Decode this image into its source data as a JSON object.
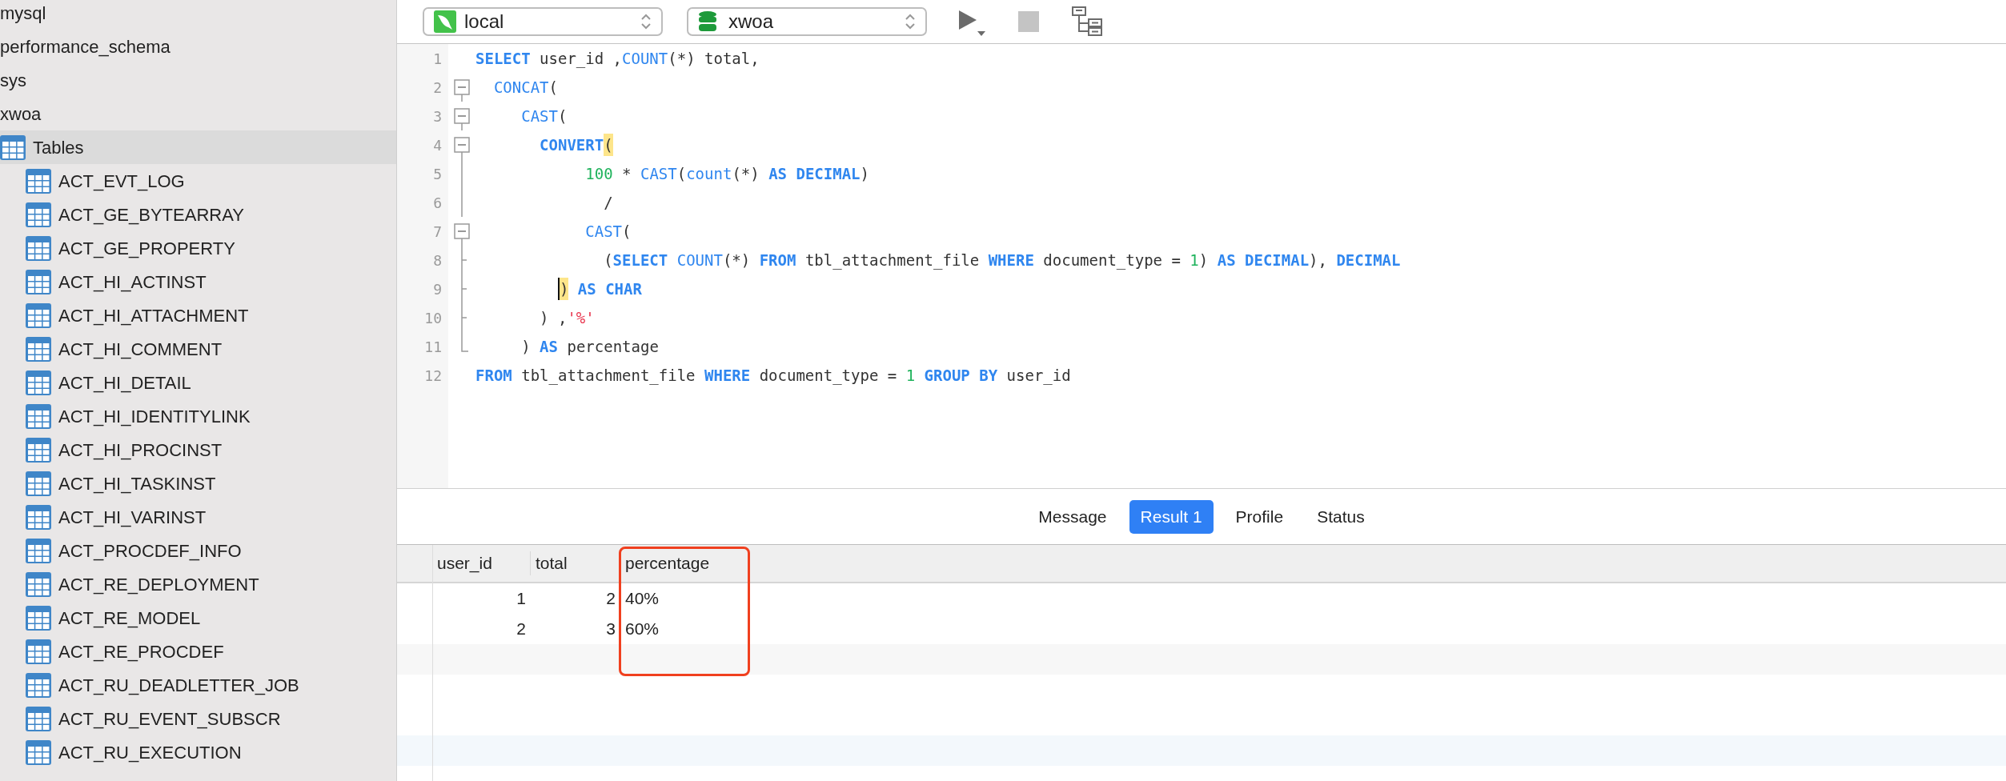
{
  "sidebar": {
    "items": [
      {
        "label": "mysql",
        "selected": false
      },
      {
        "label": "performance_schema",
        "selected": false
      },
      {
        "label": "sys",
        "selected": false
      },
      {
        "label": "xwoa",
        "selected": false,
        "children": [
          {
            "label": "Tables",
            "selected": true,
            "children": [
              {
                "label": "ACT_EVT_LOG",
                "selected": false
              },
              {
                "label": "ACT_GE_BYTEARRAY",
                "selected": false
              },
              {
                "label": "ACT_GE_PROPERTY",
                "selected": false
              },
              {
                "label": "ACT_HI_ACTINST",
                "selected": false
              },
              {
                "label": "ACT_HI_ATTACHMENT",
                "selected": false
              },
              {
                "label": "ACT_HI_COMMENT",
                "selected": false
              },
              {
                "label": "ACT_HI_DETAIL",
                "selected": false
              },
              {
                "label": "ACT_HI_IDENTITYLINK",
                "selected": false
              },
              {
                "label": "ACT_HI_PROCINST",
                "selected": false
              },
              {
                "label": "ACT_HI_TASKINST",
                "selected": false
              },
              {
                "label": "ACT_HI_VARINST",
                "selected": false
              },
              {
                "label": "ACT_PROCDEF_INFO",
                "selected": false
              },
              {
                "label": "ACT_RE_DEPLOYMENT",
                "selected": false
              },
              {
                "label": "ACT_RE_MODEL",
                "selected": false
              },
              {
                "label": "ACT_RE_PROCDEF",
                "selected": false
              },
              {
                "label": "ACT_RU_DEADLETTER_JOB",
                "selected": false
              },
              {
                "label": "ACT_RU_EVENT_SUBSCR",
                "selected": false
              },
              {
                "label": "ACT_RU_EXECUTION",
                "selected": false
              }
            ]
          }
        ]
      }
    ]
  },
  "toolbar": {
    "connection": "local",
    "database": "xwoa",
    "buttons": [
      {
        "kind": "run",
        "disabled": false
      },
      {
        "kind": "stop",
        "disabled": true
      },
      {
        "kind": "explain",
        "disabled": false
      }
    ]
  },
  "editor": {
    "lines": [
      {
        "number": "1",
        "tokens": [
          {
            "kind": "kw",
            "text": "SELECT"
          },
          {
            "kind": "plain",
            "text": " user_id ,"
          },
          {
            "kind": "fn",
            "text": "COUNT"
          },
          {
            "kind": "plain",
            "text": "(*) total,"
          }
        ]
      },
      {
        "number": "2",
        "kind": "fold_open",
        "tokens": [
          {
            "kind": "fn",
            "text": "  CONCAT"
          },
          {
            "kind": "plain",
            "text": "("
          }
        ]
      },
      {
        "number": "3",
        "kind": "fold_open",
        "tokens": [
          {
            "kind": "fn",
            "text": "     CAST"
          },
          {
            "kind": "plain",
            "text": "("
          }
        ]
      },
      {
        "number": "4",
        "kind": "fold_open",
        "tokens": [
          {
            "kind": "kw",
            "text": "       CONVERT"
          },
          {
            "kind": "plain",
            "text": "(",
            "match": true
          }
        ]
      },
      {
        "number": "5",
        "kind": "fold_line",
        "tokens": [
          {
            "kind": "num",
            "text": "            100"
          },
          {
            "kind": "plain",
            "text": " * "
          },
          {
            "kind": "fn",
            "text": "CAST"
          },
          {
            "kind": "plain",
            "text": "("
          },
          {
            "kind": "fn",
            "text": "count"
          },
          {
            "kind": "plain",
            "text": "(*) "
          },
          {
            "kind": "kw",
            "text": "AS DECIMAL"
          },
          {
            "kind": "plain",
            "text": ")"
          }
        ]
      },
      {
        "number": "6",
        "kind": "fold_line",
        "tokens": [
          {
            "kind": "plain",
            "text": "              /"
          }
        ]
      },
      {
        "number": "7",
        "kind": "fold_open",
        "tokens": [
          {
            "kind": "fn",
            "text": "            CAST"
          },
          {
            "kind": "plain",
            "text": "("
          }
        ]
      },
      {
        "number": "8",
        "kind": "fold_branch",
        "tokens": [
          {
            "kind": "plain",
            "text": "              ("
          },
          {
            "kind": "kw",
            "text": "SELECT"
          },
          {
            "kind": "fn",
            "text": " COUNT"
          },
          {
            "kind": "plain",
            "text": "(*) "
          },
          {
            "kind": "kw",
            "text": "FROM"
          },
          {
            "kind": "plain",
            "text": " tbl_attachment_file "
          },
          {
            "kind": "kw",
            "text": "WHERE"
          },
          {
            "kind": "plain",
            "text": " document_type = "
          },
          {
            "kind": "num",
            "text": "1"
          },
          {
            "kind": "plain",
            "text": ") "
          },
          {
            "kind": "kw",
            "text": "AS DECIMAL"
          },
          {
            "kind": "plain",
            "text": "), "
          },
          {
            "kind": "kw",
            "text": "DECIMAL"
          }
        ]
      },
      {
        "number": "9",
        "kind": "fold_branch",
        "tokens": [
          {
            "kind": "plain",
            "text": "         )",
            "match": true,
            "cursor_before": true
          },
          {
            "kind": "kw",
            "text": " AS CHAR"
          }
        ]
      },
      {
        "number": "10",
        "kind": "fold_branch",
        "tokens": [
          {
            "kind": "plain",
            "text": "       ) ,"
          },
          {
            "kind": "str",
            "text": "'%'"
          }
        ]
      },
      {
        "number": "11",
        "kind": "fold_end",
        "tokens": [
          {
            "kind": "plain",
            "text": "     ) "
          },
          {
            "kind": "kw",
            "text": "AS"
          },
          {
            "kind": "plain",
            "text": " percentage"
          }
        ]
      },
      {
        "number": "12",
        "tokens": [
          {
            "kind": "kw",
            "text": "FROM"
          },
          {
            "kind": "plain",
            "text": " tbl_attachment_file "
          },
          {
            "kind": "kw",
            "text": "WHERE"
          },
          {
            "kind": "plain",
            "text": " document_type = "
          },
          {
            "kind": "num",
            "text": "1"
          },
          {
            "kind": "kw",
            "text": " GROUP BY"
          },
          {
            "kind": "plain",
            "text": " user_id"
          }
        ]
      }
    ]
  },
  "result_tabs": [
    {
      "label": "Message",
      "selected": false
    },
    {
      "label": "Result 1",
      "selected": true
    },
    {
      "label": "Profile",
      "selected": false
    },
    {
      "label": "Status",
      "selected": false
    }
  ],
  "result_grid": {
    "columns": [
      {
        "name": "user_id",
        "kind": "number",
        "highlighted": false
      },
      {
        "name": "total",
        "kind": "number",
        "highlighted": false
      },
      {
        "name": "percentage",
        "kind": "text",
        "highlighted": true
      }
    ],
    "rows": [
      [
        "1",
        "2",
        "40%"
      ],
      [
        "2",
        "3",
        "60%"
      ]
    ]
  }
}
